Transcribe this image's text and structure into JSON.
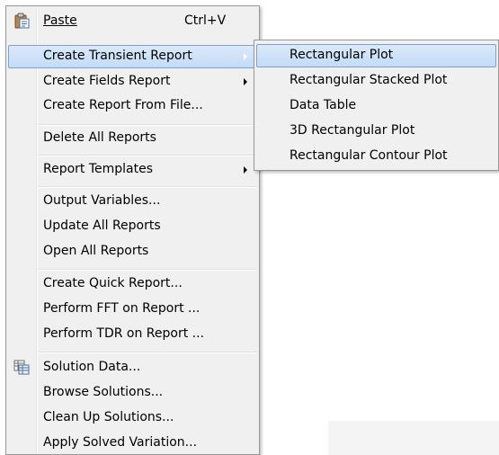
{
  "menu": {
    "paste": {
      "label": "Paste",
      "shortcut": "Ctrl+V"
    },
    "create_transient_report": "Create Transient Report",
    "create_fields_report": "Create Fields Report",
    "create_report_from_file": "Create Report From File...",
    "delete_all_reports": "Delete All Reports",
    "report_templates": "Report Templates",
    "output_variables": "Output Variables...",
    "update_all_reports": "Update All Reports",
    "open_all_reports": "Open All Reports",
    "create_quick_report": "Create Quick Report...",
    "perform_fft": "Perform FFT on Report ...",
    "perform_tdr": "Perform TDR on Report ...",
    "solution_data": "Solution Data...",
    "browse_solutions": "Browse Solutions...",
    "clean_up_solutions": "Clean Up Solutions...",
    "apply_solved_variation": "Apply Solved Variation..."
  },
  "submenu": {
    "items": [
      "Rectangular Plot",
      "Rectangular Stacked Plot",
      "Data Table",
      "3D Rectangular Plot",
      "Rectangular Contour Plot"
    ]
  },
  "icons": {
    "paste": "clipboard-icon",
    "solution_data": "table-data-icon"
  },
  "colors": {
    "menu_bg": "#f0f0f0",
    "highlight_border": "#7da2ce",
    "highlight_fill": "#c3dcf7"
  }
}
